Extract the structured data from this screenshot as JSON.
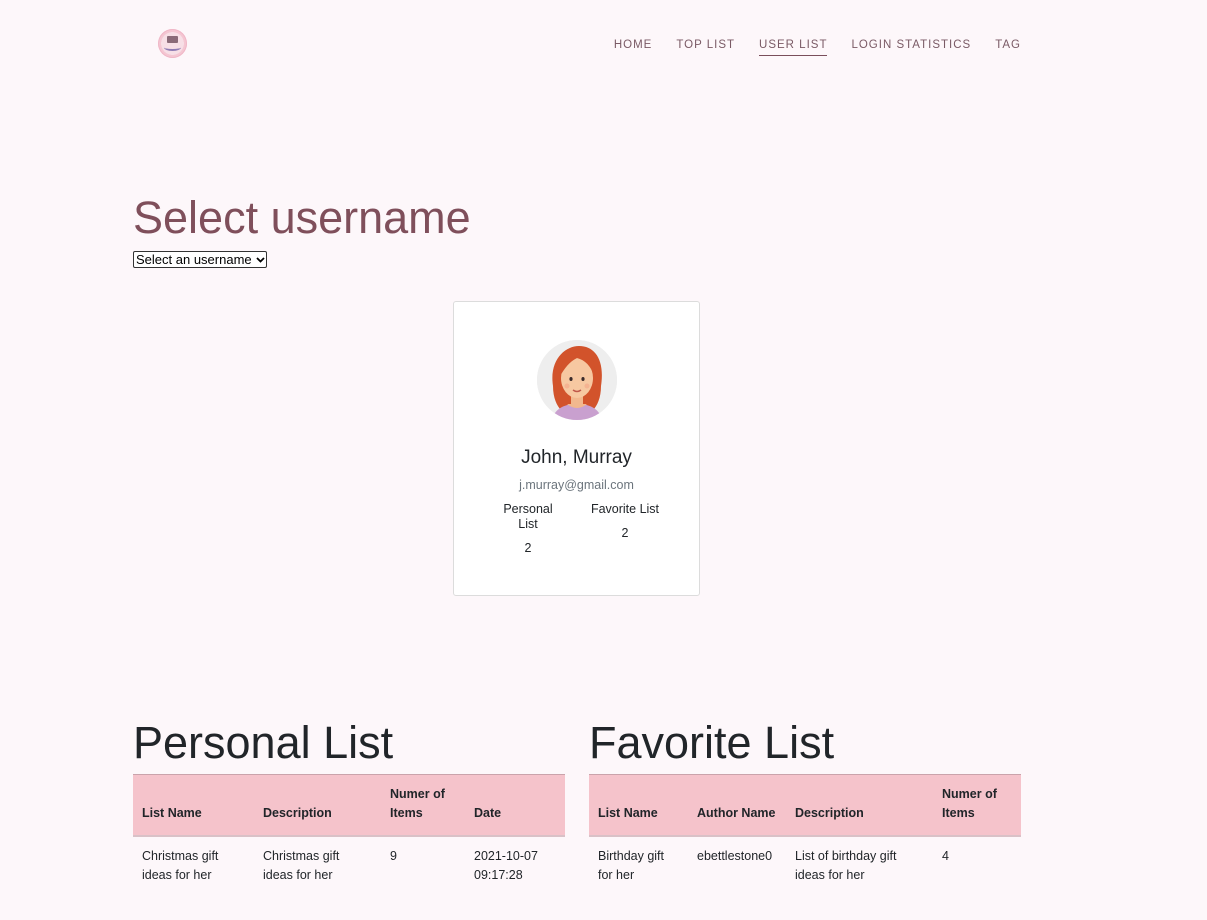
{
  "header": {
    "nav": [
      {
        "label": "HOME"
      },
      {
        "label": "TOP LIST"
      },
      {
        "label": "USER LIST",
        "active": true
      },
      {
        "label": "LOGIN STATISTICS"
      },
      {
        "label": "TAG"
      }
    ]
  },
  "main": {
    "title": "Select username",
    "select": {
      "selected": "Select an username"
    }
  },
  "profile": {
    "name": "John, Murray",
    "email": "j.murray@gmail.com",
    "personal_label": "Personal List",
    "personal_count": "2",
    "favorite_label": "Favorite List",
    "favorite_count": "2"
  },
  "personal_list": {
    "title": "Personal List",
    "columns": [
      "List Name",
      "Description",
      "Numer of Items",
      "Date"
    ],
    "rows": [
      [
        "Christmas gift ideas for her",
        "Christmas gift ideas for her",
        "9",
        "2021-10-07 09:17:28"
      ]
    ]
  },
  "favorite_list": {
    "title": "Favorite List",
    "columns": [
      "List Name",
      "Author Name",
      "Description",
      "Numer of Items"
    ],
    "rows": [
      [
        "Birthday gift for her",
        "ebettlestone0",
        "List of birthday gift ideas for her",
        "4"
      ]
    ]
  },
  "colors": {
    "background": "#fdf7fa",
    "accent": "#7f4f5b",
    "table_header": "#f5c3cb"
  }
}
